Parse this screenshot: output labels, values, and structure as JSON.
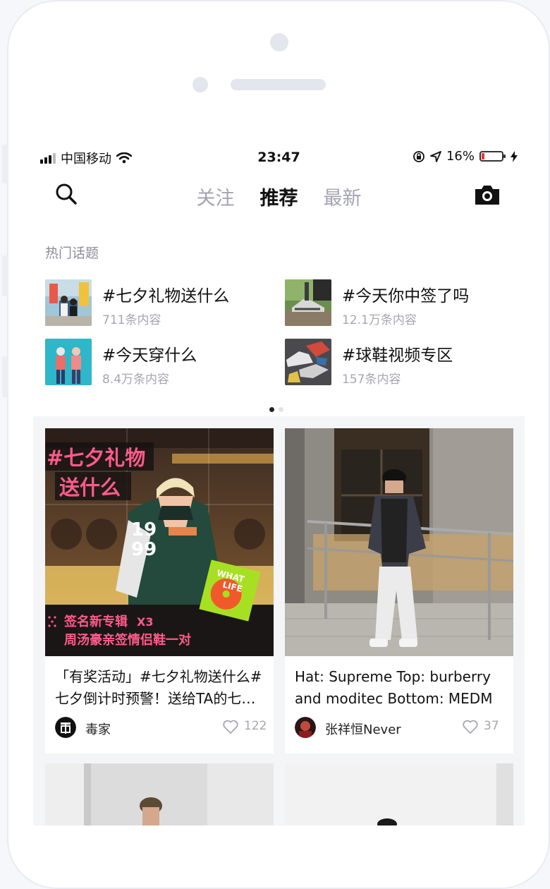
{
  "status_bar": {
    "carrier": "中国移动",
    "time": "23:47",
    "battery_percent": "16%",
    "battery_level": 0.16,
    "icons": [
      "signal-icon",
      "wifi-icon",
      "orientation-lock-icon",
      "location-icon",
      "battery-icon",
      "charging-icon"
    ]
  },
  "nav": {
    "tabs": [
      {
        "label": "关注",
        "active": false
      },
      {
        "label": "推荐",
        "active": true
      },
      {
        "label": "最新",
        "active": false
      }
    ],
    "icons": [
      "search-icon",
      "camera-icon"
    ]
  },
  "topics": {
    "title": "热门话题",
    "items": [
      {
        "name": "#七夕礼物送什么",
        "count": "711条内容"
      },
      {
        "name": "#今天你中签了吗",
        "count": "12.1万条内容"
      },
      {
        "name": "#今天穿什么",
        "count": "8.4万条内容"
      },
      {
        "name": "#球鞋视频专区",
        "count": "157条内容"
      }
    ],
    "page_dots": {
      "total": 2,
      "active": 0
    }
  },
  "feed": [
    {
      "title": "「有奖活动」#七夕礼物送什么# 七夕倒计时预警！送给TA的七夕礼物",
      "author": "毒家",
      "likes": "122",
      "image_text": {
        "headline_line1": "#七夕礼物",
        "headline_line2": "送什么",
        "jersey_top": "19",
        "jersey_bottom": "99",
        "album_line1": "WHAT",
        "album_line2": "LIFE",
        "promo_line1": "签名新专辑",
        "promo_times": "X3",
        "promo_line2": "周汤豪亲签情侣鞋一对"
      }
    },
    {
      "title": "Hat: Supreme Top: burberry and moditec Bottom: MEDM",
      "author": "张祥恒Never",
      "likes": "37"
    }
  ],
  "colors": {
    "accent_pink": "#ff5a8c",
    "text_primary": "#111111",
    "text_secondary": "#a6a6b2",
    "tab_inactive": "#a3a3b5"
  }
}
